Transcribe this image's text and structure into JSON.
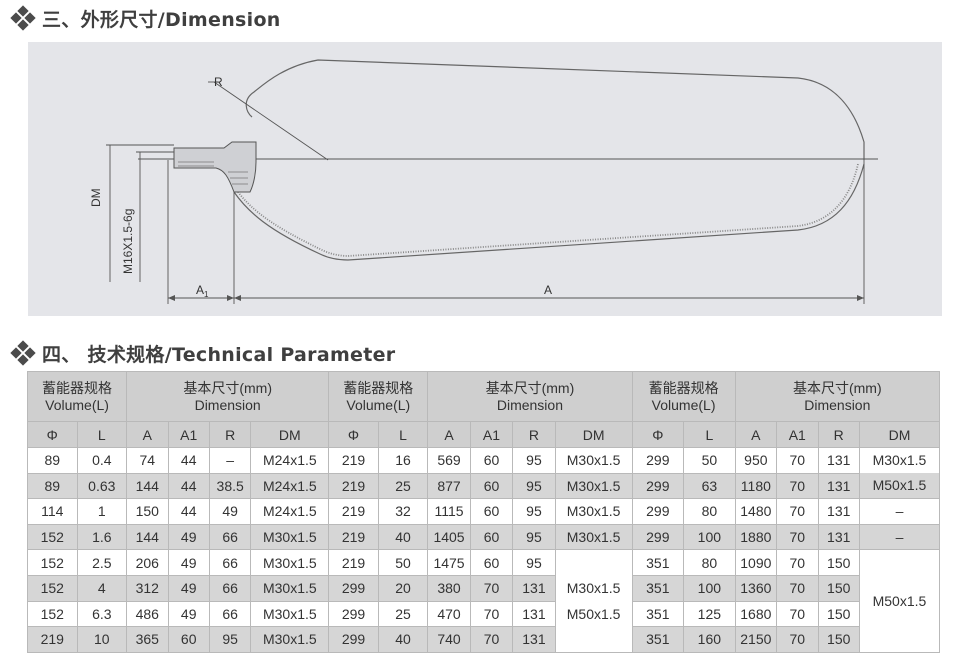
{
  "sections": {
    "dimension_title": "三、外形尺寸/Dimension",
    "technical_title": "四、 技术规格/Technical Parameter"
  },
  "drawing": {
    "labels": {
      "r": "R",
      "dm": "DM",
      "thread": "M16X1.5-6g",
      "a1": "A",
      "a1_sub": "1",
      "a": "A"
    }
  },
  "table": {
    "group_headers": [
      {
        "spec_line1": "蓄能器规格",
        "spec_line2": "Volume(L)",
        "dim_line1": "基本尺寸(mm)",
        "dim_line2": "Dimension"
      },
      {
        "spec_line1": "蓄能器规格",
        "spec_line2": "Volume(L)",
        "dim_line1": "基本尺寸(mm)",
        "dim_line2": "Dimension"
      },
      {
        "spec_line1": "蓄能器规格",
        "spec_line2": "Volume(L)",
        "dim_line1": "基本尺寸(mm)",
        "dim_line2": "Dimension"
      }
    ],
    "col_headers": [
      "Φ",
      "L",
      "A",
      "A1",
      "R",
      "DM",
      "Φ",
      "L",
      "A",
      "A1",
      "R",
      "DM",
      "Φ",
      "L",
      "A",
      "A1",
      "R",
      "DM"
    ],
    "rows": [
      [
        "89",
        "0.4",
        "74",
        "44",
        "–",
        "M24x1.5",
        "219",
        "16",
        "569",
        "60",
        "95",
        "M30x1.5",
        "299",
        "50",
        "950",
        "70",
        "131"
      ],
      [
        "89",
        "0.63",
        "144",
        "44",
        "38.5",
        "M24x1.5",
        "219",
        "25",
        "877",
        "60",
        "95",
        "M30x1.5",
        "299",
        "63",
        "1180",
        "70",
        "131"
      ],
      [
        "114",
        "1",
        "150",
        "44",
        "49",
        "M24x1.5",
        "219",
        "32",
        "1115",
        "60",
        "95",
        "M30x1.5",
        "299",
        "80",
        "1480",
        "70",
        "131",
        "–"
      ],
      [
        "152",
        "1.6",
        "144",
        "49",
        "66",
        "M30x1.5",
        "219",
        "40",
        "1405",
        "60",
        "95",
        "M30x1.5",
        "299",
        "100",
        "1880",
        "70",
        "131",
        "–"
      ],
      [
        "152",
        "2.5",
        "206",
        "49",
        "66",
        "M30x1.5",
        "219",
        "50",
        "1475",
        "60",
        "95",
        "351",
        "80",
        "1090",
        "70",
        "150"
      ],
      [
        "152",
        "4",
        "312",
        "49",
        "66",
        "M30x1.5",
        "299",
        "20",
        "380",
        "70",
        "131",
        "351",
        "100",
        "1360",
        "70",
        "150"
      ],
      [
        "152",
        "6.3",
        "486",
        "49",
        "66",
        "M30x1.5",
        "299",
        "25",
        "470",
        "70",
        "131",
        "351",
        "125",
        "1680",
        "70",
        "150"
      ],
      [
        "219",
        "10",
        "365",
        "60",
        "95",
        "M30x1.5",
        "299",
        "40",
        "740",
        "70",
        "131",
        "351",
        "160",
        "2150",
        "70",
        "150"
      ]
    ],
    "split_cell_top": "M30x1.5",
    "split_cell_bottom": "M50x1.5",
    "merged_mid_line1": "M30x1.5",
    "merged_mid_line2": "M50x1.5",
    "merged_right": "M50x1.5"
  }
}
